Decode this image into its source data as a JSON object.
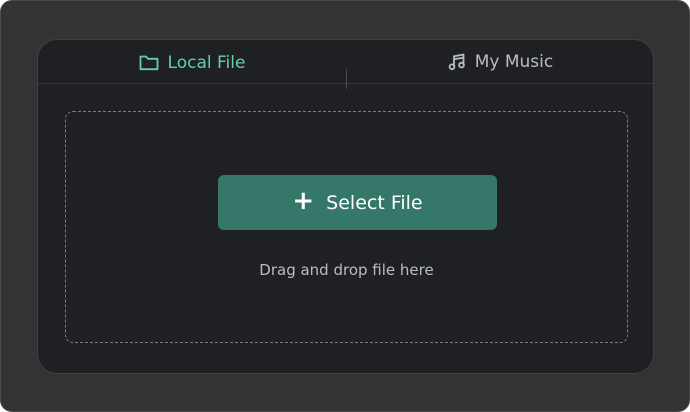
{
  "tabs": {
    "local_label": "Local File",
    "music_label": "My Music",
    "active": "local"
  },
  "dropzone": {
    "button_label": "Select File",
    "button_icon": "+",
    "hint": "Drag and drop file here"
  },
  "colors": {
    "active_tab": "#5fd3a4",
    "inactive_tab": "#b9bcc2",
    "button_bg": "#35786a",
    "panel_bg": "#1f2024",
    "window_bg": "#333333"
  },
  "icons": {
    "local_tab": "folder-icon",
    "music_tab": "music-note-icon",
    "button": "plus-icon"
  }
}
